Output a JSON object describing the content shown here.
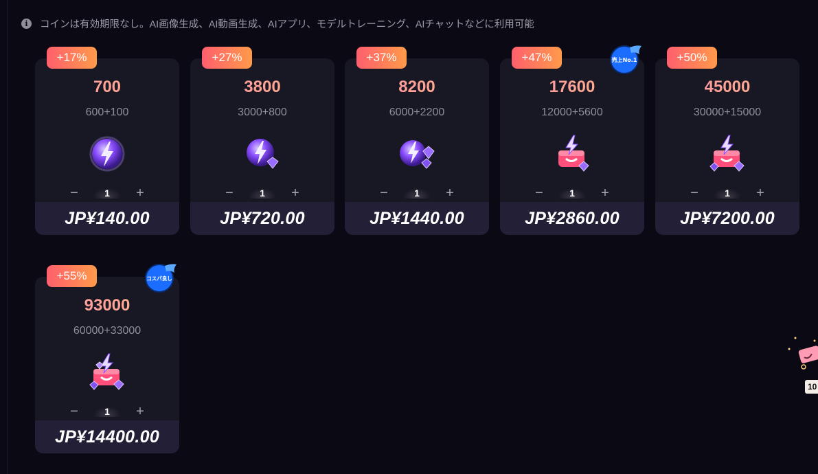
{
  "notice": {
    "icon": "info-icon",
    "text": "コインは有効期限なし。AI画像生成、AI動画生成、AIアプリ、モデルトレーニング、AIチャットなどに利用可能"
  },
  "cards": [
    {
      "bonus": "+17%",
      "coins": "700",
      "breakdown": "600+100",
      "qty": "1",
      "price": "JP¥140.00",
      "ribbon": "",
      "icon": "lightning-orb-icon"
    },
    {
      "bonus": "+27%",
      "coins": "3800",
      "breakdown": "3000+800",
      "qty": "1",
      "price": "JP¥720.00",
      "ribbon": "",
      "icon": "lightning-orb-small-gem-icon"
    },
    {
      "bonus": "+37%",
      "coins": "8200",
      "breakdown": "6000+2200",
      "qty": "1",
      "price": "JP¥1440.00",
      "ribbon": "",
      "icon": "lightning-orb-gems-icon"
    },
    {
      "bonus": "+47%",
      "coins": "17600",
      "breakdown": "12000+5600",
      "qty": "1",
      "price": "JP¥2860.00",
      "ribbon": "売上No.1",
      "icon": "treasure-box-icon"
    },
    {
      "bonus": "+50%",
      "coins": "45000",
      "breakdown": "30000+15000",
      "qty": "1",
      "price": "JP¥7200.00",
      "ribbon": "",
      "icon": "treasure-box-gems-icon"
    },
    {
      "bonus": "+55%",
      "coins": "93000",
      "breakdown": "60000+33000",
      "qty": "1",
      "price": "JP¥14400.00",
      "ribbon": "コスパ良し",
      "icon": "treasure-box-full-icon"
    }
  ],
  "stepper": {
    "minus": "−",
    "plus": "+"
  },
  "floating": {
    "label": "10",
    "icon": "gift-cart-icon"
  },
  "colors": {
    "background": "#0b0a14",
    "card": "#181724",
    "price_bar": "#231f36",
    "badge_start": "#ff5f6d",
    "badge_end": "#ff9a4a",
    "ribbon": "#1a6dff"
  }
}
